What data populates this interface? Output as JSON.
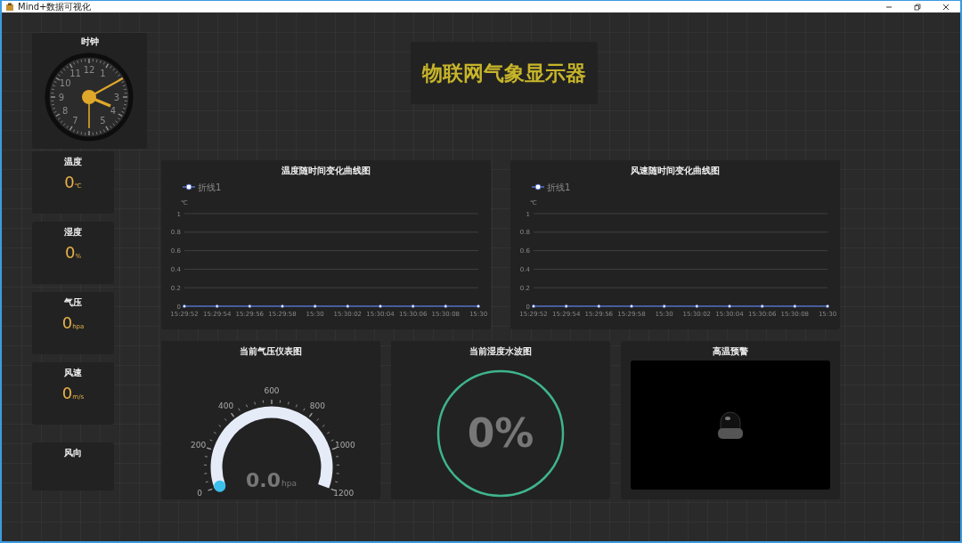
{
  "window": {
    "title": "Mind+数据可视化"
  },
  "clock": {
    "title": "时钟",
    "dial_numbers": [
      "11",
      "12",
      "1",
      "10",
      "3",
      "9",
      "4",
      "8",
      "5",
      "7"
    ]
  },
  "header": {
    "title": "物联网气象显示器"
  },
  "readings": [
    {
      "label": "温度",
      "value": "0",
      "unit": "℃"
    },
    {
      "label": "湿度",
      "value": "0",
      "unit": "%"
    },
    {
      "label": "气压",
      "value": "0",
      "unit": "hpa"
    },
    {
      "label": "风速",
      "value": "0",
      "unit": "m/s"
    },
    {
      "label": "风向"
    }
  ],
  "charts": [
    {
      "title": "温度随时间变化曲线图",
      "chart_data": {
        "type": "line",
        "ylabel": "℃",
        "categories": [
          "15:29:52",
          "15:29:54",
          "15:29:56",
          "15:29:58",
          "15:30",
          "15:30:02",
          "15:30:04",
          "15:30:06",
          "15:30:08",
          "15:30"
        ],
        "grid": true,
        "series": [
          {
            "name": "折线1",
            "color": "#5470c6",
            "marker": true,
            "values": [
              0,
              0,
              0,
              0,
              0,
              0,
              0,
              0,
              0,
              0
            ]
          }
        ],
        "ylim": [
          0,
          1
        ],
        "yticks": [
          0,
          0.2,
          0.4,
          0.6,
          0.8,
          1
        ]
      }
    },
    {
      "title": "风速随时间变化曲线图",
      "chart_data": {
        "type": "line",
        "ylabel": "℃",
        "categories": [
          "15:29:52",
          "15:29:54",
          "15:29:56",
          "15:29:58",
          "15:30",
          "15:30:02",
          "15:30:04",
          "15:30:06",
          "15:30:08",
          "15:30"
        ],
        "grid": true,
        "series": [
          {
            "name": "折线1",
            "color": "#5470c6",
            "marker": true,
            "values": [
              0,
              0,
              0,
              0,
              0,
              0,
              0,
              0,
              0,
              0
            ]
          }
        ],
        "ylim": [
          0,
          1
        ],
        "yticks": [
          0,
          0.2,
          0.4,
          0.6,
          0.8,
          1
        ]
      }
    }
  ],
  "gauge": {
    "title": "当前气压仪表图",
    "value": "0.0",
    "unit": "hpa",
    "level": 0,
    "scale_labels": [
      "0",
      "200",
      "400",
      "600",
      "800",
      "1000",
      "1200"
    ]
  },
  "water_ball": {
    "title": "当前湿度水波图",
    "reading": "0%"
  },
  "alarm": {
    "title": "高温预警",
    "on": false
  }
}
